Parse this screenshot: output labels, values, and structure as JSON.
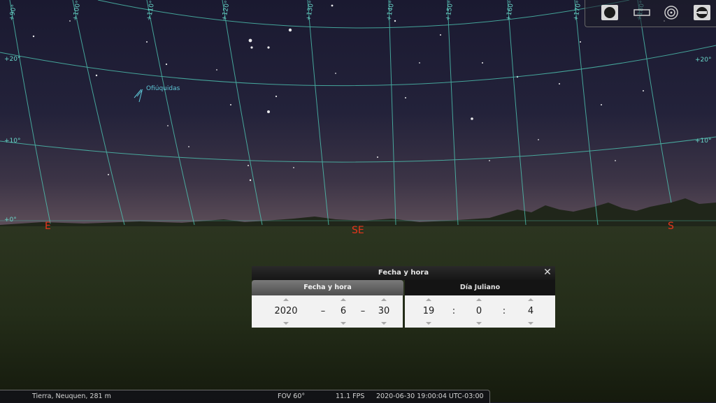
{
  "sky": {
    "ra_labels": [
      "+90°",
      "+100°",
      "+110°",
      "+120°",
      "+130°",
      "+140°",
      "+150°",
      "+160°",
      "+170°",
      "+180°"
    ],
    "dec_labels_left": [
      "+20°",
      "+10°",
      "+0°"
    ],
    "dec_labels_right": [
      "+20°",
      "+10°"
    ],
    "cardinals": {
      "east": "E",
      "southeast": "SE",
      "south": "S"
    },
    "object_label": "Ofiúquidas",
    "colors": {
      "grid": "#4fc7b4",
      "cardinal": "#e8351c",
      "object_label": "#5fc8d8"
    }
  },
  "toolbar": {
    "buttons": [
      {
        "icon": "moon-disk-icon"
      },
      {
        "icon": "rectangle-icon"
      },
      {
        "icon": "target-icon"
      },
      {
        "icon": "telescope-icon"
      }
    ]
  },
  "dialog": {
    "title": "Fecha y hora",
    "close_label": "✕",
    "tabs": {
      "date_time": "Fecha y hora",
      "julian": "Día Juliano"
    },
    "year": "2020",
    "month": "6",
    "day": "30",
    "date_sep": "–",
    "hour": "19",
    "minute": "0",
    "second": "4",
    "time_sep": ":"
  },
  "status": {
    "location": "Tierra, Neuquen, 281 m",
    "fov": "FOV 60°",
    "fps": "11.1 FPS",
    "datetime": "2020-06-30 19:00:04 UTC-03:00"
  }
}
